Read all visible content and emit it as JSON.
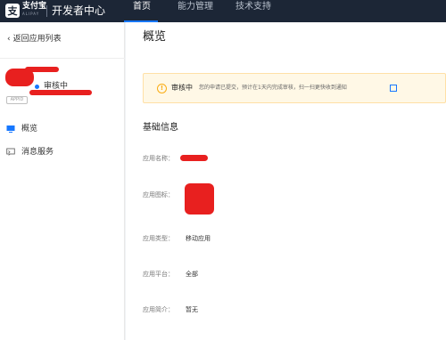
{
  "header": {
    "logo_glyph": "支",
    "logo_text": "支付宝",
    "logo_sub": "ALIPAY",
    "site_title": "开发者中心",
    "nav": [
      {
        "label": "首页",
        "active": true
      },
      {
        "label": "能力管理",
        "active": false
      },
      {
        "label": "技术支持",
        "active": false
      }
    ]
  },
  "sidebar": {
    "back_label": "返回应用列表",
    "status": "审核中",
    "appid_tag": "APPID",
    "menu": [
      {
        "label": "概览",
        "icon": "monitor-icon"
      },
      {
        "label": "消息服务",
        "icon": "message-icon"
      }
    ]
  },
  "main": {
    "page_title": "概览",
    "alert": {
      "title": "审核中",
      "message": "您的申请已提交，预计在1天内完成审核，扫一扫更快收到通知",
      "icon": "warning-icon"
    },
    "section_title": "基础信息",
    "fields": [
      {
        "label": "应用名称：",
        "value": ""
      },
      {
        "label": "应用图标：",
        "value": ""
      },
      {
        "label": "应用类型：",
        "value": "移动应用"
      },
      {
        "label": "应用平台：",
        "value": "全部"
      },
      {
        "label": "应用简介：",
        "value": "暂无"
      }
    ]
  },
  "colors": {
    "topbar": "#1c2636",
    "accent": "#1677ff",
    "warning": "#faad14",
    "redaction": "#e8201f"
  }
}
